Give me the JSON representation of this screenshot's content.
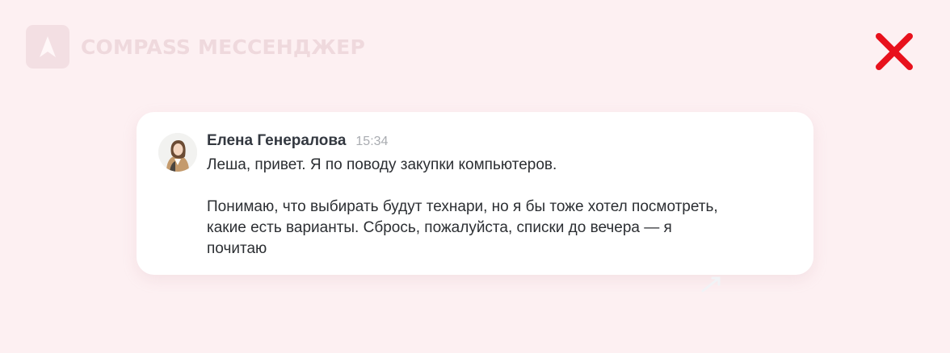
{
  "app": {
    "logo_icon": "compass-arrow-icon",
    "logo_text": "COMPASS МЕССЕНДЖЕР",
    "close_icon": "close-icon"
  },
  "message": {
    "author": "Елена Генералова",
    "time": "15:34",
    "line1": "Леша, привет. Я по поводу закупки компьютеров.",
    "line2": "Понимаю, что выбирать будут технари, но я бы тоже хотел посмотреть,",
    "line3": "какие есть варианты. Сбрось, пожалуйста, списки до вечера — я",
    "line4": "почитаю"
  },
  "colors": {
    "background": "#fdf0f2",
    "close": "#e8111c",
    "card": "#ffffff"
  }
}
